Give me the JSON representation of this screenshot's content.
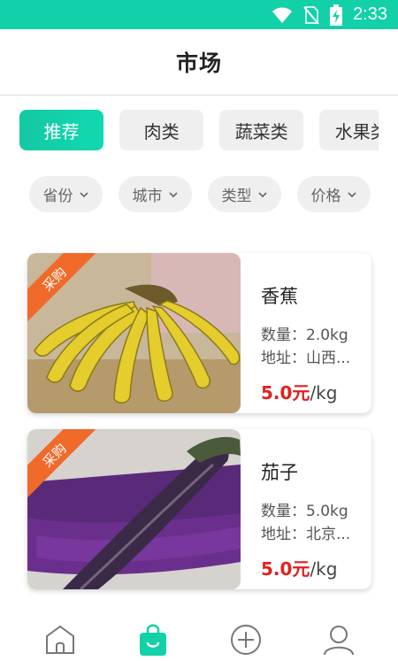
{
  "status_bar": {
    "time": "2:33",
    "icons": [
      "wifi-icon",
      "no-sim-icon",
      "battery-charging-icon"
    ]
  },
  "header": {
    "title": "市场"
  },
  "tabs": [
    {
      "label": "推荐",
      "active": true
    },
    {
      "label": "肉类",
      "active": false
    },
    {
      "label": "蔬菜类",
      "active": false
    },
    {
      "label": "水果类",
      "active": false
    }
  ],
  "filters": [
    {
      "label": "省份"
    },
    {
      "label": "城市"
    },
    {
      "label": "类型"
    },
    {
      "label": "价格"
    }
  ],
  "products": [
    {
      "badge": "采购",
      "name": "香蕉",
      "quantity": "数量：2.0kg",
      "address": "地址：山西...",
      "price": "5.0元",
      "unit": "/kg"
    },
    {
      "badge": "采购",
      "name": "茄子",
      "quantity": "数量：5.0kg",
      "address": "地址：北京...",
      "price": "5.0元",
      "unit": "/kg"
    }
  ],
  "bottom_nav": {
    "items": [
      {
        "icon": "home-icon",
        "active": false
      },
      {
        "icon": "shopping-bag-icon",
        "active": true
      },
      {
        "icon": "add-circle-icon",
        "active": false
      },
      {
        "icon": "profile-icon",
        "active": false
      }
    ]
  },
  "colors": {
    "accent": "#12d1a8",
    "price": "#e02020",
    "badge": "#f06a2a"
  }
}
